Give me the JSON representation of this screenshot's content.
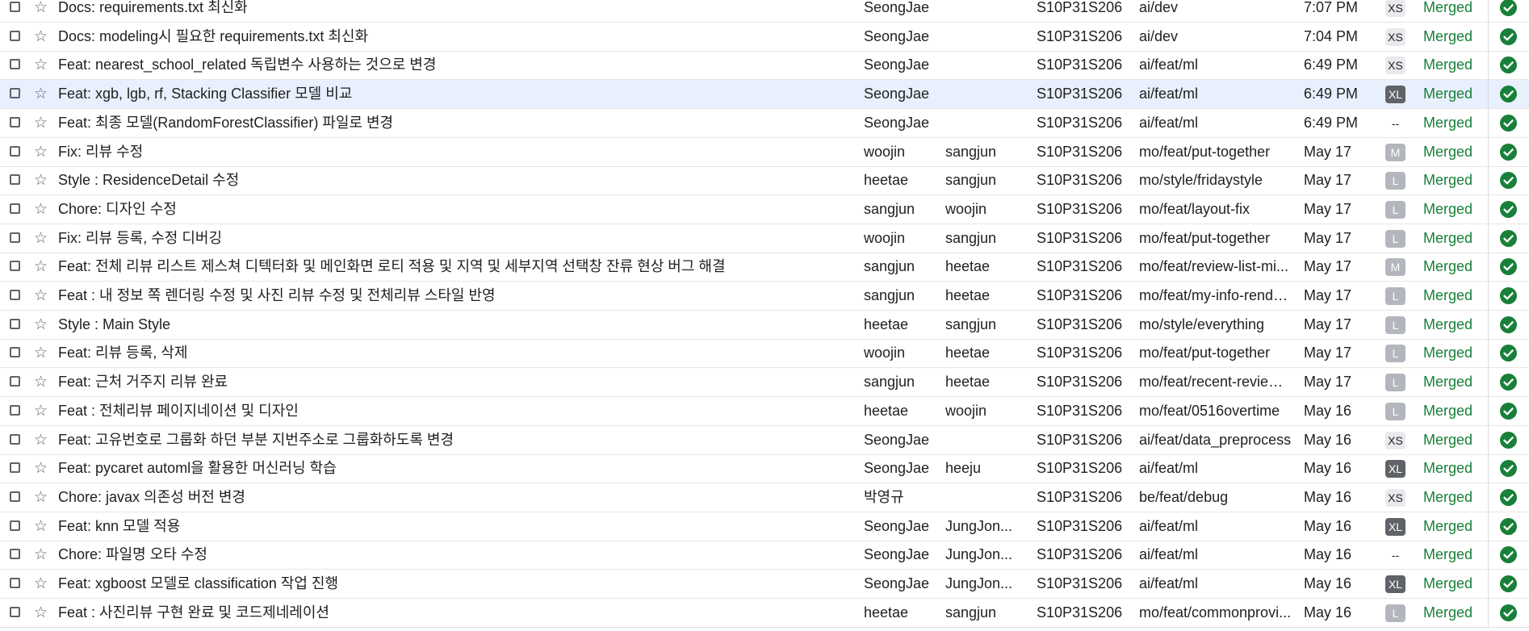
{
  "rows": [
    {
      "title": "Docs: requirements.txt 최신화",
      "author": "SeongJae",
      "reviewer": "",
      "project": "S10P31S206",
      "branch": "ai/dev",
      "time": "7:07 PM",
      "size": "XS",
      "status": "Merged"
    },
    {
      "title": "Docs: modeling시 필요한 requirements.txt 최신화",
      "author": "SeongJae",
      "reviewer": "",
      "project": "S10P31S206",
      "branch": "ai/dev",
      "time": "7:04 PM",
      "size": "XS",
      "status": "Merged"
    },
    {
      "title": "Feat: nearest_school_related 독립변수 사용하는 것으로 변경",
      "author": "SeongJae",
      "reviewer": "",
      "project": "S10P31S206",
      "branch": "ai/feat/ml",
      "time": "6:49 PM",
      "size": "XS",
      "status": "Merged"
    },
    {
      "title": "Feat: xgb, lgb, rf, Stacking Classifier 모델 비교",
      "author": "SeongJae",
      "reviewer": "",
      "project": "S10P31S206",
      "branch": "ai/feat/ml",
      "time": "6:49 PM",
      "size": "XL",
      "status": "Merged",
      "highlight": true
    },
    {
      "title": "Feat: 최종 모델(RandomForestClassifier) 파일로 변경",
      "author": "SeongJae",
      "reviewer": "",
      "project": "S10P31S206",
      "branch": "ai/feat/ml",
      "time": "6:49 PM",
      "size": "--",
      "status": "Merged"
    },
    {
      "title": "Fix: 리뷰 수정",
      "author": "woojin",
      "reviewer": "sangjun",
      "project": "S10P31S206",
      "branch": "mo/feat/put-together",
      "time": "May 17",
      "size": "M",
      "status": "Merged"
    },
    {
      "title": "Style : ResidenceDetail 수정",
      "author": "heetae",
      "reviewer": "sangjun",
      "project": "S10P31S206",
      "branch": "mo/style/fridaystyle",
      "time": "May 17",
      "size": "L",
      "status": "Merged"
    },
    {
      "title": "Chore: 디자인 수정",
      "author": "sangjun",
      "reviewer": "woojin",
      "project": "S10P31S206",
      "branch": "mo/feat/layout-fix",
      "time": "May 17",
      "size": "L",
      "status": "Merged"
    },
    {
      "title": "Fix: 리뷰 등록, 수정 디버깅",
      "author": "woojin",
      "reviewer": "sangjun",
      "project": "S10P31S206",
      "branch": "mo/feat/put-together",
      "time": "May 17",
      "size": "L",
      "status": "Merged"
    },
    {
      "title": "Feat: 전체 리뷰 리스트 제스쳐 디텍터화 및 메인화면 로티 적용 및 지역 및 세부지역 선택창 잔류 현상 버그 해결",
      "author": "sangjun",
      "reviewer": "heetae",
      "project": "S10P31S206",
      "branch": "mo/feat/review-list-mi...",
      "time": "May 17",
      "size": "M",
      "status": "Merged"
    },
    {
      "title": "Feat : 내 정보 쪽 렌더링 수정 및 사진 리뷰 수정 및 전체리뷰 스타일 반영",
      "author": "sangjun",
      "reviewer": "heetae",
      "project": "S10P31S206",
      "branch": "mo/feat/my-info-rende...",
      "time": "May 17",
      "size": "L",
      "status": "Merged"
    },
    {
      "title": "Style : Main Style",
      "author": "heetae",
      "reviewer": "sangjun",
      "project": "S10P31S206",
      "branch": "mo/style/everything",
      "time": "May 17",
      "size": "L",
      "status": "Merged"
    },
    {
      "title": "Feat: 리뷰 등록, 삭제",
      "author": "woojin",
      "reviewer": "heetae",
      "project": "S10P31S206",
      "branch": "mo/feat/put-together",
      "time": "May 17",
      "size": "L",
      "status": "Merged"
    },
    {
      "title": "Feat: 근처 거주지 리뷰 완료",
      "author": "sangjun",
      "reviewer": "heetae",
      "project": "S10P31S206",
      "branch": "mo/feat/recent-review-...",
      "time": "May 17",
      "size": "L",
      "status": "Merged"
    },
    {
      "title": "Feat : 전체리뷰 페이지네이션 및 디자인",
      "author": "heetae",
      "reviewer": "woojin",
      "project": "S10P31S206",
      "branch": "mo/feat/0516overtime",
      "time": "May 16",
      "size": "L",
      "status": "Merged"
    },
    {
      "title": "Feat: 고유번호로 그룹화 하던 부분 지번주소로 그룹화하도록 변경",
      "author": "SeongJae",
      "reviewer": "",
      "project": "S10P31S206",
      "branch": "ai/feat/data_preprocess",
      "time": "May 16",
      "size": "XS",
      "status": "Merged"
    },
    {
      "title": "Feat: pycaret automl을 활용한 머신러닝 학습",
      "author": "SeongJae",
      "reviewer": "heeju",
      "project": "S10P31S206",
      "branch": "ai/feat/ml",
      "time": "May 16",
      "size": "XL",
      "status": "Merged"
    },
    {
      "title": "Chore: javax 의존성 버전 변경",
      "author": "박영규",
      "reviewer": "",
      "project": "S10P31S206",
      "branch": "be/feat/debug",
      "time": "May 16",
      "size": "XS",
      "status": "Merged"
    },
    {
      "title": "Feat: knn 모델 적용",
      "author": "SeongJae",
      "reviewer": "JungJon...",
      "project": "S10P31S206",
      "branch": "ai/feat/ml",
      "time": "May 16",
      "size": "XL",
      "status": "Merged"
    },
    {
      "title": "Chore: 파일명 오타 수정",
      "author": "SeongJae",
      "reviewer": "JungJon...",
      "project": "S10P31S206",
      "branch": "ai/feat/ml",
      "time": "May 16",
      "size": "--",
      "status": "Merged"
    },
    {
      "title": "Feat: xgboost 모델로 classification 작업 진행",
      "author": "SeongJae",
      "reviewer": "JungJon...",
      "project": "S10P31S206",
      "branch": "ai/feat/ml",
      "time": "May 16",
      "size": "XL",
      "status": "Merged"
    },
    {
      "title": "Feat : 사진리뷰 구현 완료 및 코드제네레이션",
      "author": "heetae",
      "reviewer": "sangjun",
      "project": "S10P31S206",
      "branch": "mo/feat/commonprovi...",
      "time": "May 16",
      "size": "L",
      "status": "Merged"
    }
  ]
}
